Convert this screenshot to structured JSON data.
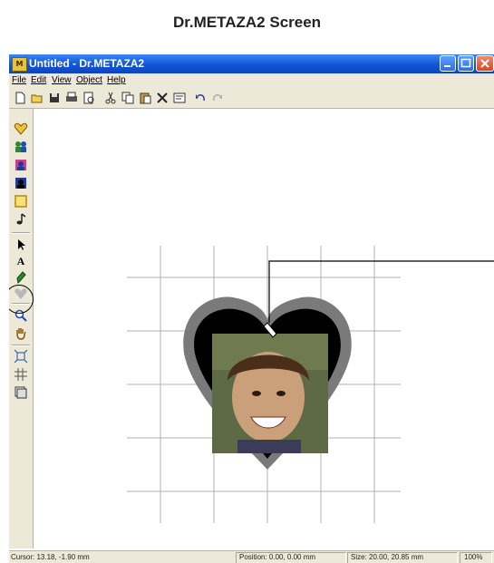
{
  "heading": "Dr.METAZA2 Screen",
  "window": {
    "title": "Untitled - Dr.METAZA2",
    "app_icon_text": "M"
  },
  "menu": [
    "File",
    "Edit",
    "View",
    "Object",
    "Help"
  ],
  "toolbar_icons": [
    "new-icon",
    "open-icon",
    "save-icon",
    "print-icon",
    "print-preview-icon",
    "cut-icon",
    "copy-icon",
    "paste-icon",
    "delete-icon",
    "properties-icon",
    "undo-icon",
    "redo-icon"
  ],
  "sidebar_icons": [
    "heart-icon",
    "people-icon",
    "portrait-icon",
    "portrait-dark-icon",
    "rectangle-icon",
    "music-note-icon",
    "pointer-icon",
    "text-icon",
    "pen-icon",
    "heart-gray-icon",
    "zoom-icon",
    "hand-icon",
    "fit-icon",
    "grid-icon",
    "layers-icon"
  ],
  "status": {
    "cursor": "Cursor: 13.18, -1.90 mm",
    "position": "Position: 0.00, 0.00 mm",
    "size": "Size: 20.00, 20.85 mm",
    "zoom": "100%"
  },
  "colors": {
    "titlebar": "#1155d8",
    "frame_gray": "#7a7a7a",
    "heart_black": "#000000"
  }
}
